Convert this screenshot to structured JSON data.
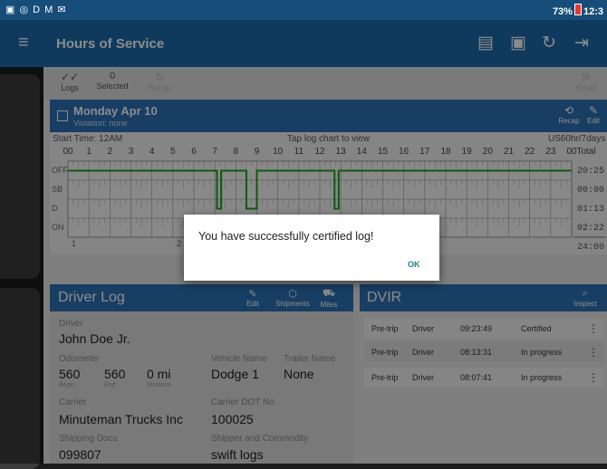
{
  "status_bar": {
    "left_icons": "▣ ◎ D M ✉",
    "battery": "73%",
    "time": "12:3"
  },
  "app_bar": {
    "title": "Hours of Service",
    "icons": [
      "menu-icon",
      "message-icon",
      "certify-icon",
      "refresh-icon",
      "logout-icon"
    ]
  },
  "toolbar": {
    "logs_label": "Logs",
    "selected_count": "0",
    "selected_label": "Selected",
    "recap_label": "Recap",
    "email_label": "Email"
  },
  "day": {
    "title": "Monday Apr 10",
    "violation": "Violation: none",
    "recap": "Recap",
    "edit": "Edit"
  },
  "chart": {
    "start_time": "Start Time: 12AM",
    "hint": "Tap log chart to view",
    "rule": "US60hr/7days",
    "hours": [
      "00",
      "1",
      "2",
      "3",
      "4",
      "5",
      "6",
      "7",
      "8",
      "9",
      "10",
      "11",
      "12",
      "13",
      "14",
      "15",
      "16",
      "17",
      "18",
      "19",
      "20",
      "21",
      "22",
      "23",
      "00"
    ],
    "total_label": "Total",
    "rows": [
      "OFF",
      "SB",
      "D",
      "ON"
    ],
    "totals": [
      "20:25",
      "00:00",
      "01:13",
      "02:22",
      "24:00"
    ],
    "bottom_numbers": [
      "1",
      "2"
    ]
  },
  "driver_log": {
    "title": "Driver Log",
    "actions": [
      "Edit",
      "Shipments",
      "Miles"
    ],
    "driver_label": "Driver",
    "driver": "John Doe Jr.",
    "odometer_label": "Odometer",
    "odo_begin": "560",
    "odo_end": "560",
    "odo_distance": "0 mi",
    "begin": "Begin",
    "end": "End",
    "distance": "Distance",
    "vehicle_label": "Vehicle Name",
    "vehicle": "Dodge 1",
    "trailer_label": "Trailer Name",
    "trailer": "None",
    "carrier_label": "Carrier",
    "carrier": "Minuteman Trucks Inc",
    "dot_label": "Carrier DOT No.",
    "dot": "100025",
    "shipping_label": "Shipping Docs",
    "shipping": "099807",
    "shipper_label": "Shipper and Commodity",
    "shipper": "swift logs"
  },
  "dvir": {
    "title": "DVIR",
    "inspect": "Inspect",
    "rows": [
      {
        "type": "Pre-trip",
        "who": "Driver",
        "time": "09:23:49",
        "status": "Certified"
      },
      {
        "type": "Pre-trip",
        "who": "Driver",
        "time": "08:13:31",
        "status": "In progress"
      },
      {
        "type": "Pre-trip",
        "who": "Driver",
        "time": "08:07:41",
        "status": "In progress"
      }
    ]
  },
  "dialog": {
    "message": "You have successfully certified log!",
    "ok": "OK"
  },
  "colors": {
    "app_bar": "#1e6aa9",
    "header": "#2c72b6",
    "status_bar": "#174d79",
    "accent": "#138a7a",
    "graph_line": "#1aa31a"
  }
}
